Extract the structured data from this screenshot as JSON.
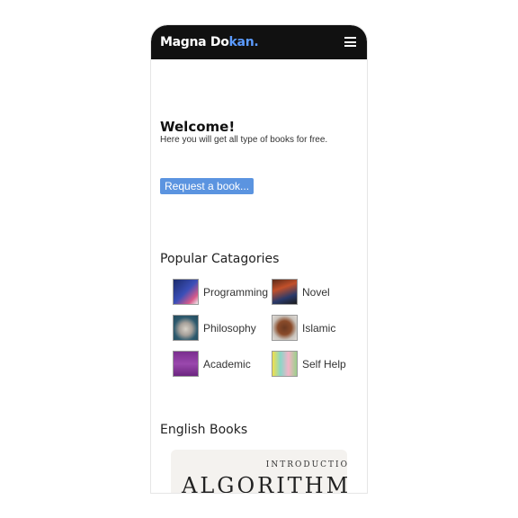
{
  "navbar": {
    "brand_main": "Magna Do",
    "brand_accent": "kan.",
    "menu_icon": "hamburger-menu-icon",
    "accent_color": "#5b9bff"
  },
  "welcome": {
    "title": "Welcome!",
    "subtitle": "Here you will get all type of books for free."
  },
  "request_button": {
    "label": "Request a book..."
  },
  "popular": {
    "title": "Popular Catagories",
    "categories": [
      {
        "label": "Programming"
      },
      {
        "label": "Novel"
      },
      {
        "label": "Philosophy"
      },
      {
        "label": "Islamic"
      },
      {
        "label": "Academic"
      },
      {
        "label": "Self Help"
      }
    ]
  },
  "english_books": {
    "title": "English Books",
    "book": {
      "cover_line1": "INTRODUCTIO",
      "cover_line2": "ALGORITHM"
    }
  }
}
